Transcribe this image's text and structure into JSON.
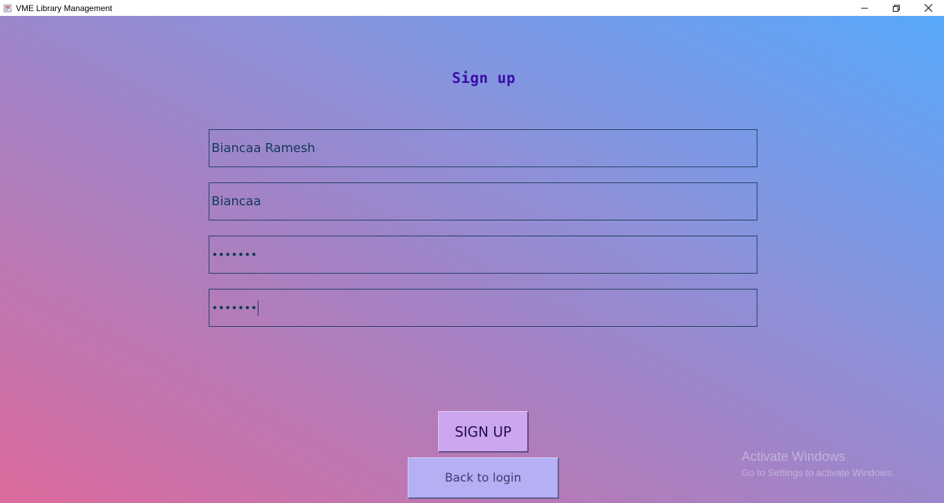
{
  "window": {
    "title": "VME Library Management",
    "icon": "app-window-icon",
    "controls": [
      "minimize-icon",
      "restore-icon",
      "close-icon"
    ]
  },
  "form": {
    "heading": "Sign up",
    "fields": [
      {
        "name": "full-name",
        "value": "Biancaa Ramesh",
        "masked": false
      },
      {
        "name": "username",
        "value": "Biancaa",
        "masked": false
      },
      {
        "name": "password",
        "value": "•••••••",
        "masked": true
      },
      {
        "name": "confirm-password",
        "value": "•••••••",
        "masked": true
      }
    ],
    "signup_label": "SIGN UP",
    "back_label": "Back to login"
  },
  "watermark": {
    "title": "Activate Windows",
    "subtitle": "Go to Settings to activate Windows."
  },
  "colors": {
    "heading": "#3a0ca3",
    "field_text": "#103a56",
    "signup_button": "#cca6ee",
    "back_button": "#b4b0f3",
    "gradient_start": "#dc6a9c",
    "gradient_end": "#58a8fb"
  }
}
